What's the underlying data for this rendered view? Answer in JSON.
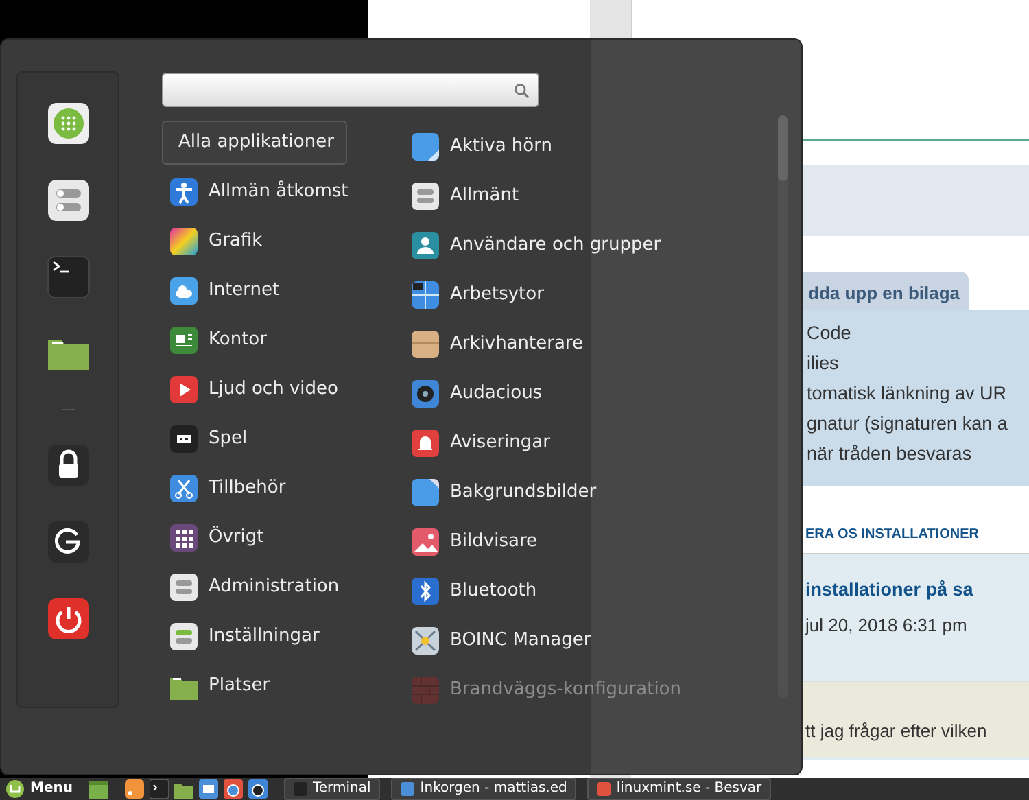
{
  "menu": {
    "categories": [
      {
        "label": "Alla applikationer",
        "selected": true
      },
      {
        "label": "Allmän åtkomst",
        "selected": false
      },
      {
        "label": "Grafik",
        "selected": false
      },
      {
        "label": "Internet",
        "selected": false
      },
      {
        "label": "Kontor",
        "selected": false
      },
      {
        "label": "Ljud och video",
        "selected": false
      },
      {
        "label": "Spel",
        "selected": false
      },
      {
        "label": "Tillbehör",
        "selected": false
      },
      {
        "label": "Övrigt",
        "selected": false
      },
      {
        "label": "Administration",
        "selected": false
      },
      {
        "label": "Inställningar",
        "selected": false
      },
      {
        "label": "Platser",
        "selected": false
      }
    ],
    "apps": [
      {
        "label": "Aktiva hörn",
        "disabled": false
      },
      {
        "label": "Allmänt",
        "disabled": false
      },
      {
        "label": "Användare och grupper",
        "disabled": false
      },
      {
        "label": "Arbetsytor",
        "disabled": false
      },
      {
        "label": "Arkivhanterare",
        "disabled": false
      },
      {
        "label": "Audacious",
        "disabled": false
      },
      {
        "label": "Aviseringar",
        "disabled": false
      },
      {
        "label": "Bakgrundsbilder",
        "disabled": false
      },
      {
        "label": "Bildvisare",
        "disabled": false
      },
      {
        "label": "Bluetooth",
        "disabled": false
      },
      {
        "label": "BOINC Manager",
        "disabled": false
      },
      {
        "label": "Brandväggs-konfiguration",
        "disabled": true
      }
    ]
  },
  "browser": {
    "tab": {
      "label": "dda upp en bilaga"
    },
    "options": [
      "Code",
      "ilies",
      "tomatisk länkning av UR",
      "gnatur (signaturen kan a",
      "när tråden besvaras"
    ],
    "history_heading": "ERA OS INSTALLATIONER",
    "post": {
      "title": "installationer på sa",
      "byline": "jul 20, 2018 6:31 pm",
      "quote": "tt jag frågar efter vilken"
    }
  },
  "taskbar": {
    "menu_label": "Menu",
    "windows": [
      {
        "label": "Terminal"
      },
      {
        "label": "Inkorgen - mattias.ed"
      },
      {
        "label": "linuxmint.se - Besvar"
      }
    ]
  }
}
